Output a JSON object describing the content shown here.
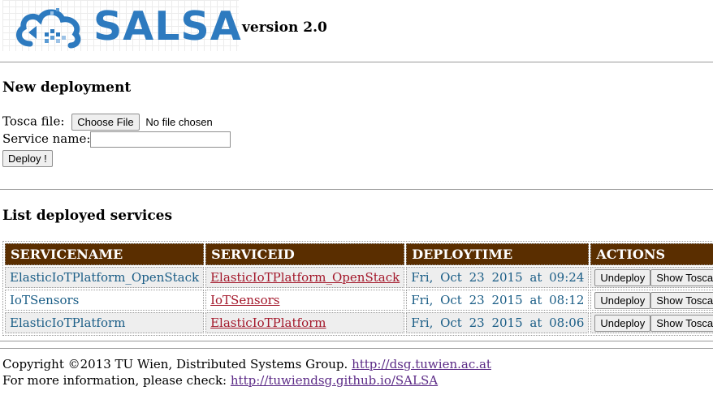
{
  "header": {
    "logo_text": "SALSA",
    "version": "version 2.0",
    "brand_color": "#2d7abf"
  },
  "deploy": {
    "heading": "New deployment",
    "tosca_label": "Tosca file:",
    "choose_file_label": "Choose File",
    "no_file_text": "No file chosen",
    "service_name_label": "Service name:",
    "service_name_value": "",
    "deploy_button": "Deploy !"
  },
  "services": {
    "heading": "List deployed services",
    "header_color": "#5a2e00",
    "columns": [
      "SERVICENAME",
      "SERVICEID",
      "DEPLOYTIME",
      "ACTIONS"
    ],
    "rows": [
      {
        "name": "ElasticIoTPlatform_OpenStack",
        "id": "ElasticIoTPlatform_OpenStack",
        "time": "Fri, Oct 23 2015 at 09:24",
        "undeploy": "Undeploy",
        "show": "Show Tosca"
      },
      {
        "name": "IoTSensors",
        "id": "IoTSensors",
        "time": "Fri, Oct 23 2015 at 08:12",
        "undeploy": "Undeploy",
        "show": "Show Tosca"
      },
      {
        "name": "ElasticIoTPlatform",
        "id": "ElasticIoTPlatform",
        "time": "Fri, Oct 23 2015 at 08:06",
        "undeploy": "Undeploy",
        "show": "Show Tosca"
      }
    ]
  },
  "footer": {
    "copyright": "Copyright ©2013 TU Wien, Distributed Systems Group.",
    "copyright_link": "http://dsg.tuwien.ac.at",
    "info": "For more information, please check:",
    "info_link": "http://tuwiendsg.github.io/SALSA"
  }
}
